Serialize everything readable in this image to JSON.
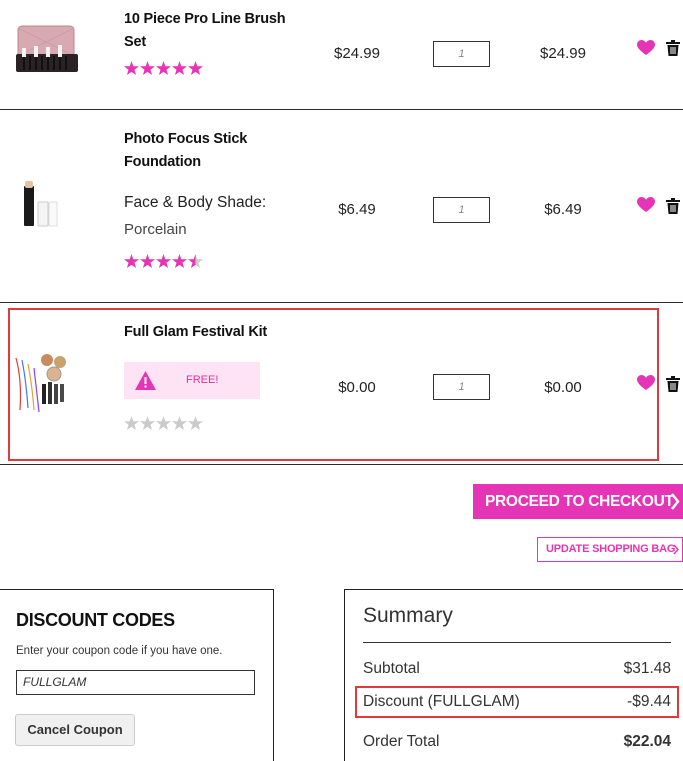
{
  "items": [
    {
      "name_line1": "10 Piece Pro Line Brush",
      "name_line2": "Set",
      "price": "$24.99",
      "qty": "1",
      "total": "$24.99",
      "rating": 5,
      "image": "brush-set-image"
    },
    {
      "name_line1": "Photo Focus Stick",
      "name_line2": "Foundation",
      "attr_label": "Face & Body Shade:",
      "attr_value": "Porcelain",
      "price": "$6.49",
      "qty": "1",
      "total": "$6.49",
      "rating": 4.5,
      "image": "foundation-stick-image"
    },
    {
      "name_line1": "Full Glam Festival Kit",
      "badge": "FREE!",
      "badge_icon": "warning-icon",
      "price": "$0.00",
      "qty": "1",
      "total": "$0.00",
      "rating": 0,
      "image": "festival-kit-image"
    }
  ],
  "actions": {
    "checkout": "PROCEED TO CHECKOUT",
    "update_bag": "UPDATE SHOPPING BAG"
  },
  "discount": {
    "title": "DISCOUNT CODES",
    "hint": "Enter your coupon code if you have one.",
    "code": "FULLGLAM",
    "cancel": "Cancel Coupon"
  },
  "summary": {
    "title": "Summary",
    "subtotal_label": "Subtotal",
    "subtotal_value": "$31.48",
    "discount_label": "Discount (FULLGLAM)",
    "discount_value": "-$9.44",
    "total_label": "Order Total",
    "total_value": "$22.04"
  },
  "colors": {
    "accent": "#e534b6",
    "highlight": "#e0393e",
    "free_bg": "#fde3f4",
    "star_off": "#cccccc"
  }
}
